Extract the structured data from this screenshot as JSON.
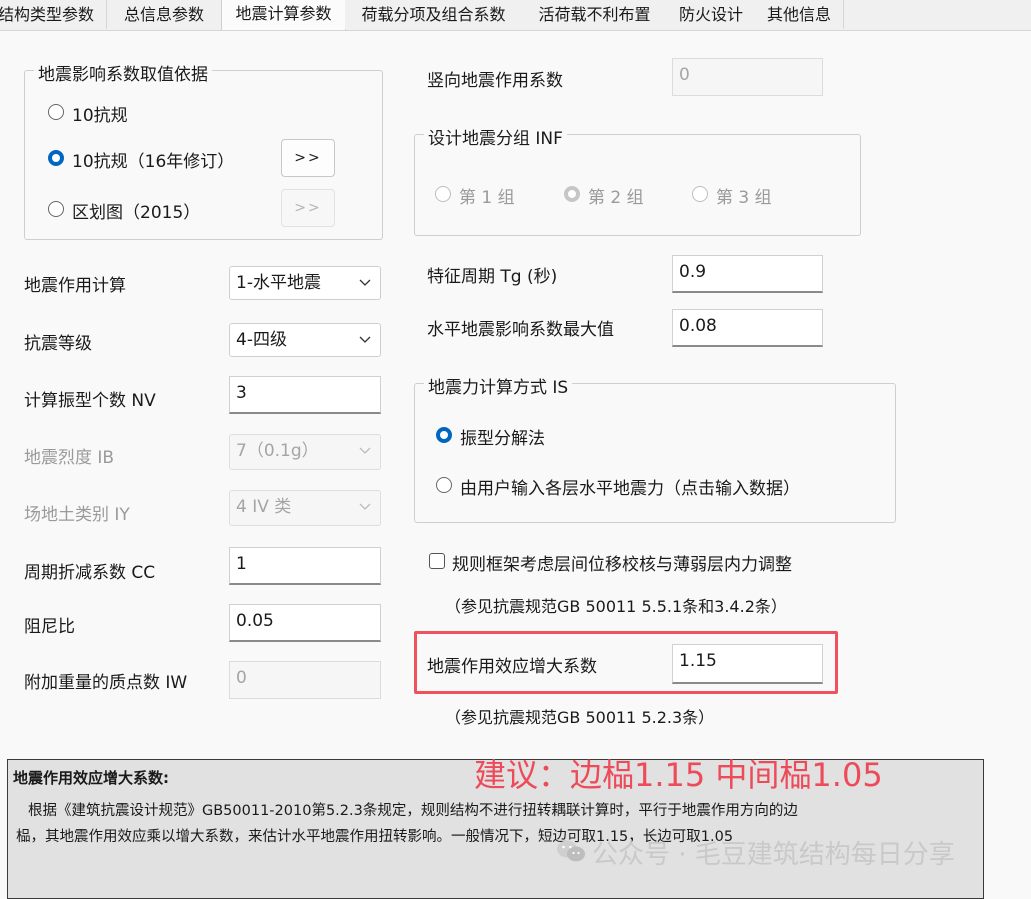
{
  "tabs": [
    "结构类型参数",
    "总信息参数",
    "地震计算参数",
    "荷载分项及组合系数",
    "活荷载不利布置",
    "防火设计",
    "其他信息"
  ],
  "active_tab": "地震计算参数",
  "basis_group": {
    "title": "地震影响系数取值依据",
    "options": [
      "10抗规",
      "10抗规（16年修订）",
      "区划图（2015）"
    ],
    "selected": "10抗规（16年修订）",
    "more_button": ">>",
    "more_button_disabled": ">>"
  },
  "left_fields": {
    "seismic_calc_label": "地震作用计算",
    "seismic_calc_value": "1-水平地震",
    "seismic_grade_label": "抗震等级",
    "seismic_grade_value": "4-四级",
    "nv_label": "计算振型个数 NV",
    "nv_value": "3",
    "ib_label": "地震烈度 IB",
    "ib_value": "7（0.1g）",
    "iy_label": "场地土类别 IY",
    "iy_value": "4  IV 类",
    "cc_label": "周期折减系数 CC",
    "cc_value": "1",
    "damping_label": "阻尼比",
    "damping_value": "0.05",
    "iw_label": "附加重量的质点数 IW",
    "iw_value": "0"
  },
  "right_fields": {
    "vertical_label": "竖向地震作用系数",
    "vertical_value": "0",
    "group_title": "设计地震分组 INF",
    "groups": [
      "第 1 组",
      "第 2 组",
      "第 3 组"
    ],
    "group_selected": "第 2 组",
    "tg_label": "特征周期 Tg (秒)",
    "tg_value": "0.9",
    "amax_label": "水平地震影响系数最大值",
    "amax_value": "0.08",
    "is_title": "地震力计算方式 IS",
    "is_options": [
      "振型分解法",
      "由用户输入各层水平地震力（点击输入数据）"
    ],
    "is_selected": "振型分解法",
    "frame_check_label": "规则框架考虑层间位移校核与薄弱层内力调整",
    "frame_check_note": "（参见抗震规范GB 50011 5.5.1条和3.4.2条）",
    "amplify_label": "地震作用效应增大系数",
    "amplify_value": "1.15",
    "amplify_note": "（参见抗震规范GB 50011 5.2.3条）"
  },
  "description": {
    "title": "地震作用效应增大系数:",
    "line1": "根据《建筑抗震设计规范》GB50011-2010第5.2.3条规定，规则结构不进行扭转耦联计算时，平行于地震作用方向的边",
    "line2": "榀，其地震作用效应乘以增大系数，来估计水平地震作用扭转影响。一般情况下，短边可取1.15，长边可取1.05"
  },
  "annotation": "建议：边榀1.15 中间榀1.05",
  "watermark": "公众号 · 毛豆建筑结构每日分享",
  "colors": {
    "accent": "#0067c0",
    "highlight": "#f0525d",
    "annotation": "#ee4b5a"
  }
}
